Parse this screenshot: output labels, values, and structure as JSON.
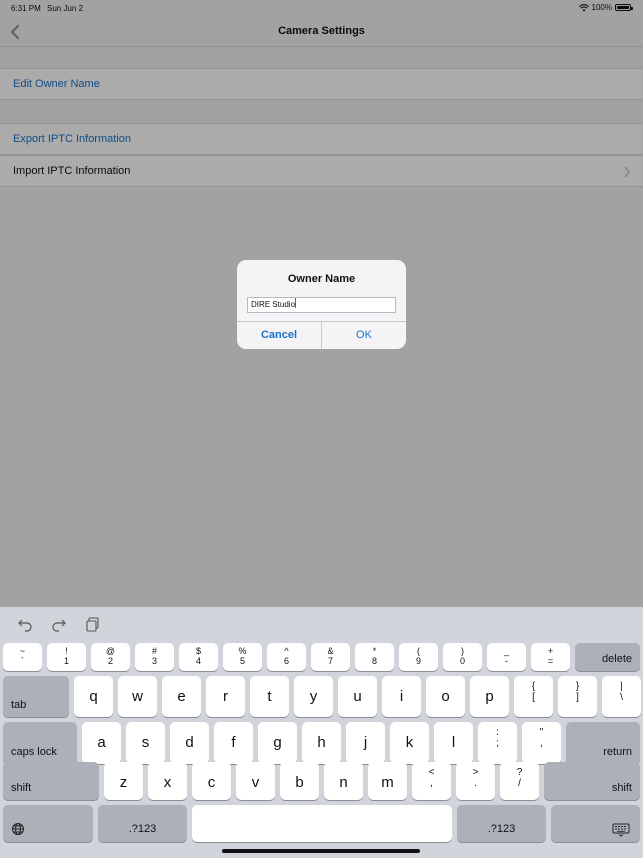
{
  "status_bar": {
    "time": "6:31 PM",
    "date": "Sun Jun 2",
    "battery": "100%"
  },
  "nav": {
    "title": "Camera Settings",
    "back_icon": "chevron-left-icon"
  },
  "settings": {
    "edit_owner": "Edit Owner Name",
    "export_iptc": "Export IPTC Information",
    "import_iptc": "Import IPTC Information"
  },
  "alert": {
    "title": "Owner Name",
    "field_value": "DIRE Studio",
    "cancel": "Cancel",
    "ok": "OK"
  },
  "keyboard": {
    "toolbar_icons": [
      "undo-icon",
      "redo-icon",
      "paste-icon"
    ],
    "row1": [
      {
        "top": "~",
        "bottom": "`"
      },
      {
        "top": "!",
        "bottom": "1"
      },
      {
        "top": "@",
        "bottom": "2"
      },
      {
        "top": "#",
        "bottom": "3"
      },
      {
        "top": "$",
        "bottom": "4"
      },
      {
        "top": "%",
        "bottom": "5"
      },
      {
        "top": "^",
        "bottom": "6"
      },
      {
        "top": "&",
        "bottom": "7"
      },
      {
        "top": "*",
        "bottom": "8"
      },
      {
        "top": "(",
        "bottom": "9"
      },
      {
        "top": ")",
        "bottom": "0"
      },
      {
        "top": "_",
        "bottom": "-"
      },
      {
        "top": "+",
        "bottom": "="
      }
    ],
    "delete": "delete",
    "tab": "tab",
    "row2": [
      "q",
      "w",
      "e",
      "r",
      "t",
      "y",
      "u",
      "i",
      "o",
      "p"
    ],
    "row2_extra": [
      {
        "top": "{",
        "bottom": "["
      },
      {
        "top": "}",
        "bottom": "]"
      },
      {
        "top": "|",
        "bottom": "\\"
      }
    ],
    "caps": "caps lock",
    "row3": [
      "a",
      "s",
      "d",
      "f",
      "g",
      "h",
      "j",
      "k",
      "l"
    ],
    "row3_extra": [
      {
        "top": ":",
        "bottom": ";"
      },
      {
        "top": "\"",
        "bottom": ","
      }
    ],
    "return": "return",
    "shift": "shift",
    "row4": [
      "z",
      "x",
      "c",
      "v",
      "b",
      "n",
      "m"
    ],
    "row4_extra": [
      {
        "top": "<",
        "bottom": ","
      },
      {
        "top": ">",
        "bottom": "."
      },
      {
        "top": "?",
        "bottom": "/"
      }
    ],
    "num_left": ".?123",
    "num_right": ".?123",
    "globe_icon": "globe-icon",
    "dismiss_icon": "keyboard-dismiss-icon"
  }
}
